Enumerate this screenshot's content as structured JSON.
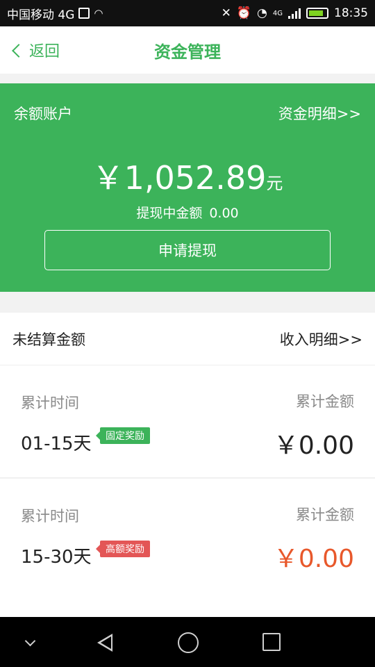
{
  "status_bar": {
    "carrier": "中国移动 4G",
    "network_badge": "4G",
    "time": "18:35",
    "icons": [
      "image-icon",
      "android-icon",
      "mute-icon",
      "alarm-icon",
      "wifi-icon",
      "signal-icon",
      "battery-icon"
    ]
  },
  "header": {
    "back_label": "返回",
    "title": "资金管理"
  },
  "balance": {
    "title": "余额账户",
    "detail_link": "资金明细>>",
    "amount": "￥1,052.89",
    "unit": "元",
    "withdrawing_label": "提现中金额",
    "withdrawing_value": "0.00",
    "apply_button": "申请提现"
  },
  "unsettled": {
    "title": "未结算金额",
    "detail_link": "收入明细>>"
  },
  "periods": [
    {
      "time_label": "累计时间",
      "amount_label": "累计金额",
      "days": "01-15天",
      "badge": "固定奖励",
      "amount": "￥0.00"
    },
    {
      "time_label": "累计时间",
      "amount_label": "累计金额",
      "days": "15-30天",
      "badge": "高额奖励",
      "amount": "￥0.00"
    }
  ],
  "colors": {
    "brand_green": "#3cb35a",
    "highlight_red": "#e35656",
    "amount_orange": "#e8582b"
  }
}
